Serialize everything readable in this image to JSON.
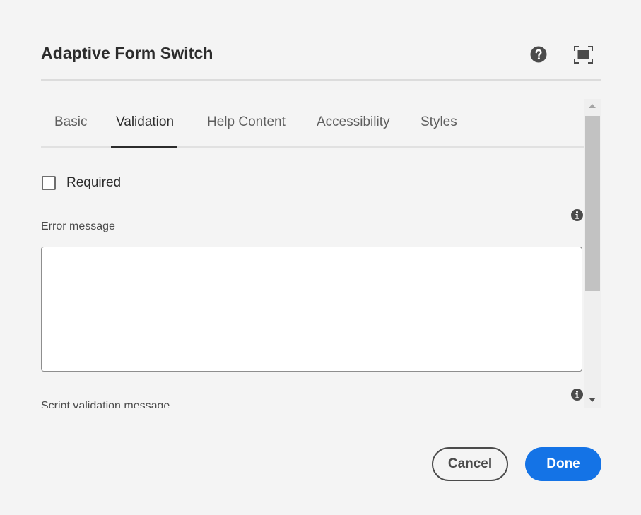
{
  "dialog": {
    "title": "Adaptive Form Switch",
    "help_icon": "help-circle-icon",
    "fullscreen_icon": "fullscreen-icon"
  },
  "tabs": [
    {
      "label": "Basic",
      "active": false
    },
    {
      "label": "Validation",
      "active": true
    },
    {
      "label": "Help Content",
      "active": false
    },
    {
      "label": "Accessibility",
      "active": false
    },
    {
      "label": "Styles",
      "active": false
    }
  ],
  "validation": {
    "required_label": "Required",
    "required_checked": false,
    "error_message_label": "Error message",
    "error_message_value": "",
    "script_validation_label": "Script validation message",
    "info_icon": "info-icon"
  },
  "buttons": {
    "cancel": "Cancel",
    "done": "Done"
  },
  "colors": {
    "primary": "#1473e6",
    "background": "#f4f4f4",
    "text": "#2c2c2c"
  }
}
